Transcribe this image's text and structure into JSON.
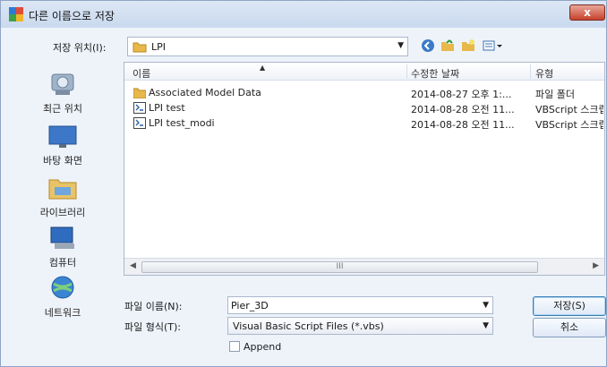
{
  "window": {
    "title": "다른 이름으로 저장",
    "close_glyph": "x"
  },
  "toolbar": {
    "save_in_label": "저장 위치(I):",
    "save_in_value": "LPI",
    "icons": [
      "back-icon",
      "up-folder-icon",
      "new-folder-icon",
      "view-menu-icon"
    ]
  },
  "places": [
    {
      "label": "최근 위치",
      "icon": "recent-places-icon"
    },
    {
      "label": "바탕 화면",
      "icon": "desktop-icon"
    },
    {
      "label": "라이브러리",
      "icon": "libraries-icon"
    },
    {
      "label": "컴퓨터",
      "icon": "computer-icon"
    },
    {
      "label": "네트워크",
      "icon": "network-icon"
    }
  ],
  "filelist": {
    "columns": [
      "이름",
      "수정한 날짜",
      "유형"
    ],
    "rows": [
      {
        "name": "Associated Model Data",
        "date": "2014-08-27 오후 1:...",
        "type": "파일 폴더",
        "icon": "folder-icon"
      },
      {
        "name": "LPI test",
        "date": "2014-08-28 오전 11...",
        "type": "VBScript 스크립트",
        "icon": "vbscript-file-icon"
      },
      {
        "name": "LPI test_modi",
        "date": "2014-08-28 오전 11...",
        "type": "VBScript 스크립트",
        "icon": "vbscript-file-icon"
      }
    ],
    "scroll_grip": "III"
  },
  "form": {
    "filename_label": "파일 이름(N):",
    "filename_value": "Pier_3D",
    "filetype_label": "파일 형식(T):",
    "filetype_value": "Visual Basic Script Files (*.vbs)",
    "save_button": "저장(S)",
    "cancel_button": "취소",
    "append_label": "Append"
  },
  "colors": {
    "background": "#eef3fa",
    "folder": "#e8b84a",
    "close": "#c7412c"
  }
}
